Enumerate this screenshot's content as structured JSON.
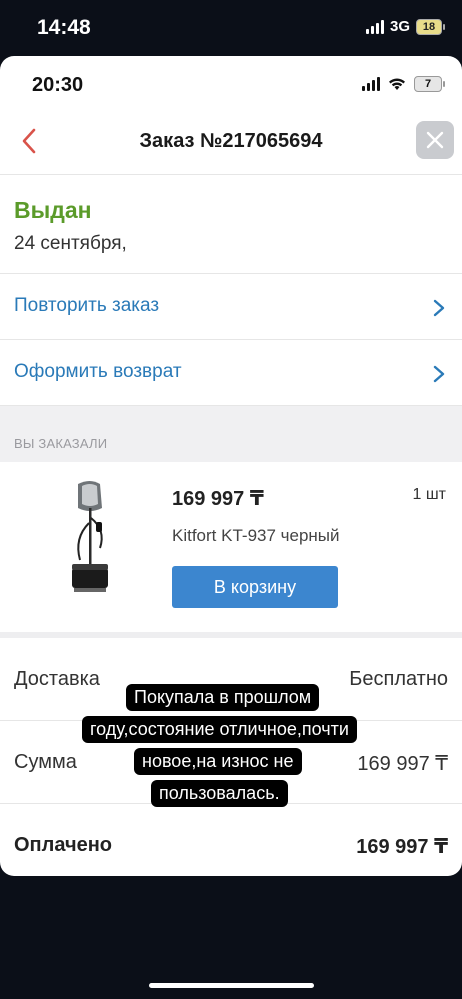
{
  "outer_status": {
    "time": "14:48",
    "network": "3G",
    "battery": "18"
  },
  "inner_status": {
    "time": "20:30",
    "battery": "7"
  },
  "header": {
    "title": "Заказ №217065694",
    "back_icon": "chevron-left-icon",
    "close_icon": "close-icon"
  },
  "order_status": {
    "label": "Выдан",
    "date": "24 сентября,",
    "color": "#5b9b2a"
  },
  "actions": [
    {
      "label": "Повторить заказ"
    },
    {
      "label": "Оформить возврат"
    }
  ],
  "section_caption": "ВЫ ЗАКАЗАЛИ",
  "product": {
    "price": "169 997 ₸",
    "quantity": "1 шт",
    "name": "Kitfort KT-937 черный",
    "cart_button": "В корзину"
  },
  "summary": [
    {
      "label": "Доставка",
      "value": "Бесплатно"
    },
    {
      "label": "Сумма",
      "value": "169 997 ₸"
    },
    {
      "label": "Оплачено",
      "value": "169 997 ₸"
    }
  ],
  "caption_overlay": [
    "Покупала в прошлом",
    "году,состояние отличное,почти",
    "новое,на износ не",
    "пользовалась."
  ],
  "colors": {
    "accent_link": "#2a7ab8",
    "button": "#3c86cf",
    "status": "#5b9b2a"
  }
}
